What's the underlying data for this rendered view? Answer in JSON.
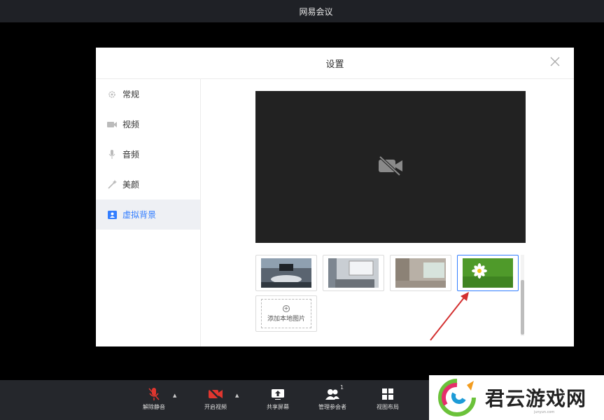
{
  "window": {
    "title": "网易会议"
  },
  "dialog": {
    "title": "设置",
    "close_icon": "close-icon",
    "nav": [
      {
        "label": "常规",
        "icon": "gear-icon"
      },
      {
        "label": "视频",
        "icon": "camera-icon"
      },
      {
        "label": "音频",
        "icon": "microphone-icon"
      },
      {
        "label": "美颜",
        "icon": "magic-wand-icon"
      },
      {
        "label": "虚拟背景",
        "icon": "portrait-icon",
        "active": true
      }
    ],
    "preview": {
      "icon": "camera-off-icon"
    },
    "backgrounds": [
      {
        "name": "meeting-room",
        "selected": false
      },
      {
        "name": "office-whiteboard",
        "selected": false
      },
      {
        "name": "lobby",
        "selected": false
      },
      {
        "name": "daisy-flower",
        "selected": true
      }
    ],
    "add_local_image": "添加本地图片"
  },
  "toolbar": {
    "items": [
      {
        "label": "解除静音",
        "icon": "microphone-muted-icon"
      },
      {
        "label": "开启视频",
        "icon": "camera-off-icon"
      },
      {
        "label": "共享屏幕",
        "icon": "share-screen-icon"
      },
      {
        "label": "管理参会者",
        "icon": "participants-icon",
        "badge": "1"
      },
      {
        "label": "视图布局",
        "icon": "grid-layout-icon"
      }
    ]
  },
  "watermark": {
    "text": "君云游戏网",
    "small": "junyun.com"
  },
  "colors": {
    "accent": "#337eff",
    "muted_red": "#e0362f"
  }
}
